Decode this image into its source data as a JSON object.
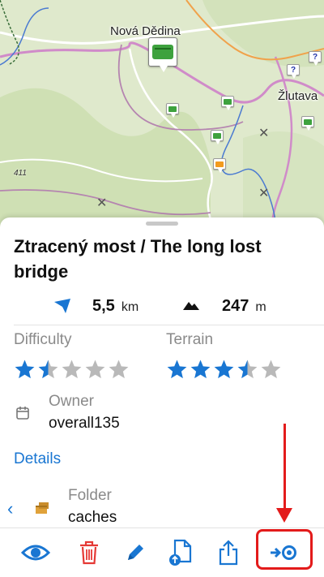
{
  "map": {
    "labels": {
      "town_1": "Nová Dědina",
      "town_2": "Žlutava",
      "road_number": "411"
    },
    "colors": {
      "background": "#dfe9cc",
      "forest": "#cfe0b4",
      "road_major": "#d08bc9",
      "road_minor": "#ffffff",
      "river": "#4b7bd1"
    }
  },
  "sheet": {
    "title": "Ztracený most / The long lost bridge",
    "distance": {
      "icon": "navigation-arrow-icon",
      "value": "5,5",
      "unit": "km"
    },
    "elevation": {
      "icon": "mountain-icon",
      "value": "247",
      "unit": "m"
    },
    "difficulty": {
      "label": "Difficulty",
      "rating": 1.5,
      "max": 5
    },
    "terrain": {
      "label": "Terrain",
      "rating": 3.5,
      "max": 5
    },
    "owner": {
      "icon": "calendar-icon",
      "label": "Owner",
      "value": "overall135"
    },
    "details_link": "Details",
    "folder": {
      "icon": "folder-boxes-icon",
      "label": "Folder",
      "value": "caches"
    }
  },
  "toolbar": {
    "items": [
      {
        "name": "eye-icon",
        "action": "show"
      },
      {
        "name": "trash-icon",
        "action": "delete"
      },
      {
        "name": "pencil-icon",
        "action": "edit"
      },
      {
        "name": "file-upload-icon",
        "action": "export"
      },
      {
        "name": "share-icon",
        "action": "share"
      },
      {
        "name": "navigate-to-icon",
        "action": "navigate"
      }
    ],
    "colors": {
      "accent": "#1976d2",
      "delete": "#e53935",
      "annotation": "#e31b1b"
    }
  }
}
